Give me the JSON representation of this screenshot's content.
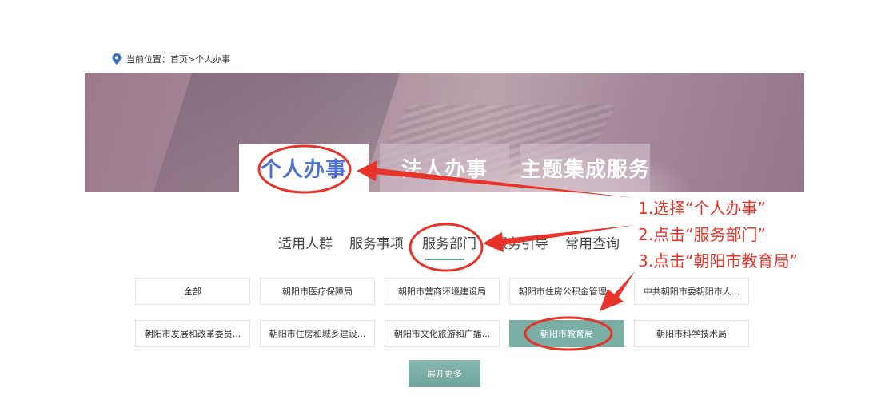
{
  "breadcrumb": {
    "prefix": "当前位置：",
    "home": "首页",
    "separator": ">",
    "current": "个人办事"
  },
  "banner_tabs": [
    {
      "label": "个人办事",
      "active": true
    },
    {
      "label": "法人办事",
      "active": false
    },
    {
      "label": "主题集成服务",
      "active": false
    }
  ],
  "subnav": [
    {
      "label": "适用人群",
      "active": false
    },
    {
      "label": "服务事项",
      "active": false
    },
    {
      "label": "服务部门",
      "active": true
    },
    {
      "label": "服务引导",
      "active": false
    },
    {
      "label": "常用查询",
      "active": false
    }
  ],
  "departments": [
    {
      "label": "全部",
      "selected": false
    },
    {
      "label": "朝阳市医疗保障局",
      "selected": false
    },
    {
      "label": "朝阳市营商环境建设局",
      "selected": false
    },
    {
      "label": "朝阳市住房公积金管理...",
      "selected": false
    },
    {
      "label": "中共朝阳市委朝阳市人...",
      "selected": false
    },
    {
      "label": "朝阳市发展和改革委员...",
      "selected": false
    },
    {
      "label": "朝阳市住房和城乡建设...",
      "selected": false
    },
    {
      "label": "朝阳市文化旅游和广播...",
      "selected": false
    },
    {
      "label": "朝阳市教育局",
      "selected": true
    },
    {
      "label": "朝阳市科学技术局",
      "selected": false
    }
  ],
  "expand_more": "展开更多",
  "instructions": [
    "1.选择“个人办事”",
    "2.点击“服务部门”",
    "3.点击“朝阳市教育局”"
  ],
  "colors": {
    "accent": "#7aafa6",
    "active_tab_text": "#4c6fd0",
    "annotation": "#e8332b"
  }
}
